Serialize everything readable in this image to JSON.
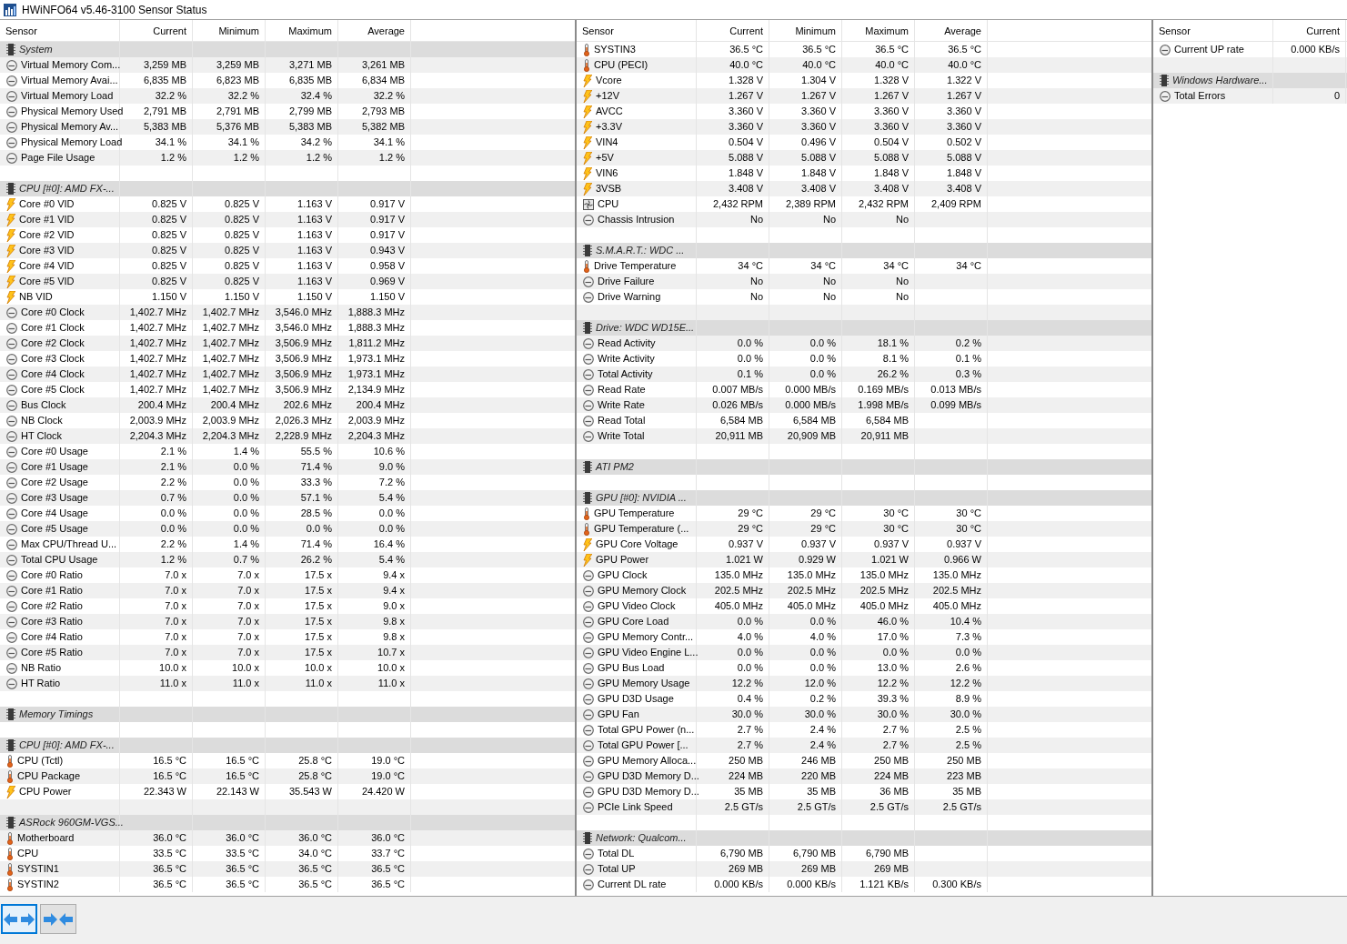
{
  "window": {
    "title": "HWiNFO64 v5.46-3100 Sensor Status"
  },
  "panels": [
    {
      "columns": [
        "Sensor",
        "Current",
        "Minimum",
        "Maximum",
        "Average"
      ],
      "rows": [
        {
          "kind": "group",
          "label": "System"
        },
        {
          "kind": "gauge",
          "label": "Virtual Memory Com...",
          "values": [
            "3,259 MB",
            "3,259 MB",
            "3,271 MB",
            "3,261 MB"
          ]
        },
        {
          "kind": "gauge",
          "label": "Virtual Memory Avai...",
          "values": [
            "6,835 MB",
            "6,823 MB",
            "6,835 MB",
            "6,834 MB"
          ]
        },
        {
          "kind": "gauge",
          "label": "Virtual Memory Load",
          "values": [
            "32.2 %",
            "32.2 %",
            "32.4 %",
            "32.2 %"
          ]
        },
        {
          "kind": "gauge",
          "label": "Physical Memory Used",
          "values": [
            "2,791 MB",
            "2,791 MB",
            "2,799 MB",
            "2,793 MB"
          ]
        },
        {
          "kind": "gauge",
          "label": "Physical Memory Av...",
          "values": [
            "5,383 MB",
            "5,376 MB",
            "5,383 MB",
            "5,382 MB"
          ]
        },
        {
          "kind": "gauge",
          "label": "Physical Memory Load",
          "values": [
            "34.1 %",
            "34.1 %",
            "34.2 %",
            "34.1 %"
          ]
        },
        {
          "kind": "gauge",
          "label": "Page File Usage",
          "values": [
            "1.2 %",
            "1.2 %",
            "1.2 %",
            "1.2 %"
          ]
        },
        {
          "kind": "blank"
        },
        {
          "kind": "group",
          "label": "CPU [#0]: AMD FX-..."
        },
        {
          "kind": "volt",
          "label": "Core #0 VID",
          "values": [
            "0.825 V",
            "0.825 V",
            "1.163 V",
            "0.917 V"
          ]
        },
        {
          "kind": "volt",
          "label": "Core #1 VID",
          "values": [
            "0.825 V",
            "0.825 V",
            "1.163 V",
            "0.917 V"
          ]
        },
        {
          "kind": "volt",
          "label": "Core #2 VID",
          "values": [
            "0.825 V",
            "0.825 V",
            "1.163 V",
            "0.917 V"
          ]
        },
        {
          "kind": "volt",
          "label": "Core #3 VID",
          "values": [
            "0.825 V",
            "0.825 V",
            "1.163 V",
            "0.943 V"
          ]
        },
        {
          "kind": "volt",
          "label": "Core #4 VID",
          "values": [
            "0.825 V",
            "0.825 V",
            "1.163 V",
            "0.958 V"
          ]
        },
        {
          "kind": "volt",
          "label": "Core #5 VID",
          "values": [
            "0.825 V",
            "0.825 V",
            "1.163 V",
            "0.969 V"
          ]
        },
        {
          "kind": "volt",
          "label": "NB VID",
          "values": [
            "1.150 V",
            "1.150 V",
            "1.150 V",
            "1.150 V"
          ]
        },
        {
          "kind": "gauge",
          "label": "Core #0 Clock",
          "values": [
            "1,402.7 MHz",
            "1,402.7 MHz",
            "3,546.0 MHz",
            "1,888.3 MHz"
          ]
        },
        {
          "kind": "gauge",
          "label": "Core #1 Clock",
          "values": [
            "1,402.7 MHz",
            "1,402.7 MHz",
            "3,546.0 MHz",
            "1,888.3 MHz"
          ]
        },
        {
          "kind": "gauge",
          "label": "Core #2 Clock",
          "values": [
            "1,402.7 MHz",
            "1,402.7 MHz",
            "3,506.9 MHz",
            "1,811.2 MHz"
          ]
        },
        {
          "kind": "gauge",
          "label": "Core #3 Clock",
          "values": [
            "1,402.7 MHz",
            "1,402.7 MHz",
            "3,506.9 MHz",
            "1,973.1 MHz"
          ]
        },
        {
          "kind": "gauge",
          "label": "Core #4 Clock",
          "values": [
            "1,402.7 MHz",
            "1,402.7 MHz",
            "3,506.9 MHz",
            "1,973.1 MHz"
          ]
        },
        {
          "kind": "gauge",
          "label": "Core #5 Clock",
          "values": [
            "1,402.7 MHz",
            "1,402.7 MHz",
            "3,506.9 MHz",
            "2,134.9 MHz"
          ]
        },
        {
          "kind": "gauge",
          "label": "Bus Clock",
          "values": [
            "200.4 MHz",
            "200.4 MHz",
            "202.6 MHz",
            "200.4 MHz"
          ]
        },
        {
          "kind": "gauge",
          "label": "NB Clock",
          "values": [
            "2,003.9 MHz",
            "2,003.9 MHz",
            "2,026.3 MHz",
            "2,003.9 MHz"
          ]
        },
        {
          "kind": "gauge",
          "label": "HT Clock",
          "values": [
            "2,204.3 MHz",
            "2,204.3 MHz",
            "2,228.9 MHz",
            "2,204.3 MHz"
          ]
        },
        {
          "kind": "gauge",
          "label": "Core #0 Usage",
          "values": [
            "2.1 %",
            "1.4 %",
            "55.5 %",
            "10.6 %"
          ]
        },
        {
          "kind": "gauge",
          "label": "Core #1 Usage",
          "values": [
            "2.1 %",
            "0.0 %",
            "71.4 %",
            "9.0 %"
          ]
        },
        {
          "kind": "gauge",
          "label": "Core #2 Usage",
          "values": [
            "2.2 %",
            "0.0 %",
            "33.3 %",
            "7.2 %"
          ]
        },
        {
          "kind": "gauge",
          "label": "Core #3 Usage",
          "values": [
            "0.7 %",
            "0.0 %",
            "57.1 %",
            "5.4 %"
          ]
        },
        {
          "kind": "gauge",
          "label": "Core #4 Usage",
          "values": [
            "0.0 %",
            "0.0 %",
            "28.5 %",
            "0.0 %"
          ]
        },
        {
          "kind": "gauge",
          "label": "Core #5 Usage",
          "values": [
            "0.0 %",
            "0.0 %",
            "0.0 %",
            "0.0 %"
          ]
        },
        {
          "kind": "gauge",
          "label": "Max CPU/Thread U...",
          "values": [
            "2.2 %",
            "1.4 %",
            "71.4 %",
            "16.4 %"
          ]
        },
        {
          "kind": "gauge",
          "label": "Total CPU Usage",
          "values": [
            "1.2 %",
            "0.7 %",
            "26.2 %",
            "5.4 %"
          ]
        },
        {
          "kind": "gauge",
          "label": "Core #0 Ratio",
          "values": [
            "7.0 x",
            "7.0 x",
            "17.5 x",
            "9.4 x"
          ]
        },
        {
          "kind": "gauge",
          "label": "Core #1 Ratio",
          "values": [
            "7.0 x",
            "7.0 x",
            "17.5 x",
            "9.4 x"
          ]
        },
        {
          "kind": "gauge",
          "label": "Core #2 Ratio",
          "values": [
            "7.0 x",
            "7.0 x",
            "17.5 x",
            "9.0 x"
          ]
        },
        {
          "kind": "gauge",
          "label": "Core #3 Ratio",
          "values": [
            "7.0 x",
            "7.0 x",
            "17.5 x",
            "9.8 x"
          ]
        },
        {
          "kind": "gauge",
          "label": "Core #4 Ratio",
          "values": [
            "7.0 x",
            "7.0 x",
            "17.5 x",
            "9.8 x"
          ]
        },
        {
          "kind": "gauge",
          "label": "Core #5 Ratio",
          "values": [
            "7.0 x",
            "7.0 x",
            "17.5 x",
            "10.7 x"
          ]
        },
        {
          "kind": "gauge",
          "label": "NB Ratio",
          "values": [
            "10.0 x",
            "10.0 x",
            "10.0 x",
            "10.0 x"
          ]
        },
        {
          "kind": "gauge",
          "label": "HT Ratio",
          "values": [
            "11.0 x",
            "11.0 x",
            "11.0 x",
            "11.0 x"
          ]
        },
        {
          "kind": "blank"
        },
        {
          "kind": "group",
          "label": "Memory Timings"
        },
        {
          "kind": "blank"
        },
        {
          "kind": "group",
          "label": "CPU [#0]: AMD FX-..."
        },
        {
          "kind": "temp",
          "label": "CPU (Tctl)",
          "values": [
            "16.5 °C",
            "16.5 °C",
            "25.8 °C",
            "19.0 °C"
          ]
        },
        {
          "kind": "temp",
          "label": "CPU Package",
          "values": [
            "16.5 °C",
            "16.5 °C",
            "25.8 °C",
            "19.0 °C"
          ]
        },
        {
          "kind": "volt",
          "label": "CPU Power",
          "values": [
            "22.343 W",
            "22.143 W",
            "35.543 W",
            "24.420 W"
          ]
        },
        {
          "kind": "blank"
        },
        {
          "kind": "group",
          "label": "ASRock 960GM-VGS..."
        },
        {
          "kind": "temp",
          "label": "Motherboard",
          "values": [
            "36.0 °C",
            "36.0 °C",
            "36.0 °C",
            "36.0 °C"
          ]
        },
        {
          "kind": "temp",
          "label": "CPU",
          "values": [
            "33.5 °C",
            "33.5 °C",
            "34.0 °C",
            "33.7 °C"
          ]
        },
        {
          "kind": "temp",
          "label": "SYSTIN1",
          "values": [
            "36.5 °C",
            "36.5 °C",
            "36.5 °C",
            "36.5 °C"
          ]
        },
        {
          "kind": "temp",
          "label": "SYSTIN2",
          "values": [
            "36.5 °C",
            "36.5 °C",
            "36.5 °C",
            "36.5 °C"
          ]
        }
      ]
    },
    {
      "columns": [
        "Sensor",
        "Current",
        "Minimum",
        "Maximum",
        "Average"
      ],
      "rows": [
        {
          "kind": "temp",
          "label": "SYSTIN3",
          "values": [
            "36.5 °C",
            "36.5 °C",
            "36.5 °C",
            "36.5 °C"
          ]
        },
        {
          "kind": "temp",
          "label": "CPU (PECI)",
          "values": [
            "40.0 °C",
            "40.0 °C",
            "40.0 °C",
            "40.0 °C"
          ]
        },
        {
          "kind": "volt",
          "label": "Vcore",
          "values": [
            "1.328 V",
            "1.304 V",
            "1.328 V",
            "1.322 V"
          ]
        },
        {
          "kind": "volt",
          "label": "+12V",
          "values": [
            "1.267 V",
            "1.267 V",
            "1.267 V",
            "1.267 V"
          ]
        },
        {
          "kind": "volt",
          "label": "AVCC",
          "values": [
            "3.360 V",
            "3.360 V",
            "3.360 V",
            "3.360 V"
          ]
        },
        {
          "kind": "volt",
          "label": "+3.3V",
          "values": [
            "3.360 V",
            "3.360 V",
            "3.360 V",
            "3.360 V"
          ]
        },
        {
          "kind": "volt",
          "label": "VIN4",
          "values": [
            "0.504 V",
            "0.496 V",
            "0.504 V",
            "0.502 V"
          ]
        },
        {
          "kind": "volt",
          "label": "+5V",
          "values": [
            "5.088 V",
            "5.088 V",
            "5.088 V",
            "5.088 V"
          ]
        },
        {
          "kind": "volt",
          "label": "VIN6",
          "values": [
            "1.848 V",
            "1.848 V",
            "1.848 V",
            "1.848 V"
          ]
        },
        {
          "kind": "volt",
          "label": "3VSB",
          "values": [
            "3.408 V",
            "3.408 V",
            "3.408 V",
            "3.408 V"
          ]
        },
        {
          "kind": "fan",
          "label": "CPU",
          "values": [
            "2,432 RPM",
            "2,389 RPM",
            "2,432 RPM",
            "2,409 RPM"
          ]
        },
        {
          "kind": "gauge",
          "label": "Chassis Intrusion",
          "values": [
            "No",
            "No",
            "No"
          ]
        },
        {
          "kind": "blank"
        },
        {
          "kind": "group",
          "label": "S.M.A.R.T.: WDC ..."
        },
        {
          "kind": "temp",
          "label": "Drive Temperature",
          "values": [
            "34 °C",
            "34 °C",
            "34 °C",
            "34 °C"
          ]
        },
        {
          "kind": "gauge",
          "label": "Drive Failure",
          "values": [
            "No",
            "No",
            "No"
          ]
        },
        {
          "kind": "gauge",
          "label": "Drive Warning",
          "values": [
            "No",
            "No",
            "No"
          ]
        },
        {
          "kind": "blank"
        },
        {
          "kind": "group",
          "label": "Drive: WDC WD15E..."
        },
        {
          "kind": "gauge",
          "label": "Read Activity",
          "values": [
            "0.0 %",
            "0.0 %",
            "18.1 %",
            "0.2 %"
          ]
        },
        {
          "kind": "gauge",
          "label": "Write Activity",
          "values": [
            "0.0 %",
            "0.0 %",
            "8.1 %",
            "0.1 %"
          ]
        },
        {
          "kind": "gauge",
          "label": "Total Activity",
          "values": [
            "0.1 %",
            "0.0 %",
            "26.2 %",
            "0.3 %"
          ]
        },
        {
          "kind": "gauge",
          "label": "Read Rate",
          "values": [
            "0.007 MB/s",
            "0.000 MB/s",
            "0.169 MB/s",
            "0.013 MB/s"
          ]
        },
        {
          "kind": "gauge",
          "label": "Write Rate",
          "values": [
            "0.026 MB/s",
            "0.000 MB/s",
            "1.998 MB/s",
            "0.099 MB/s"
          ]
        },
        {
          "kind": "gauge",
          "label": "Read Total",
          "values": [
            "6,584 MB",
            "6,584 MB",
            "6,584 MB"
          ]
        },
        {
          "kind": "gauge",
          "label": "Write Total",
          "values": [
            "20,911 MB",
            "20,909 MB",
            "20,911 MB"
          ]
        },
        {
          "kind": "blank"
        },
        {
          "kind": "group",
          "label": "ATI PM2"
        },
        {
          "kind": "blank"
        },
        {
          "kind": "group",
          "label": "GPU [#0]: NVIDIA ..."
        },
        {
          "kind": "temp",
          "label": "GPU Temperature",
          "values": [
            "29 °C",
            "29 °C",
            "30 °C",
            "30 °C"
          ]
        },
        {
          "kind": "temp",
          "label": "GPU Temperature (...",
          "values": [
            "29 °C",
            "29 °C",
            "30 °C",
            "30 °C"
          ]
        },
        {
          "kind": "volt",
          "label": "GPU Core Voltage",
          "values": [
            "0.937 V",
            "0.937 V",
            "0.937 V",
            "0.937 V"
          ]
        },
        {
          "kind": "volt",
          "label": "GPU Power",
          "values": [
            "1.021 W",
            "0.929 W",
            "1.021 W",
            "0.966 W"
          ]
        },
        {
          "kind": "gauge",
          "label": "GPU Clock",
          "values": [
            "135.0 MHz",
            "135.0 MHz",
            "135.0 MHz",
            "135.0 MHz"
          ]
        },
        {
          "kind": "gauge",
          "label": "GPU Memory Clock",
          "values": [
            "202.5 MHz",
            "202.5 MHz",
            "202.5 MHz",
            "202.5 MHz"
          ]
        },
        {
          "kind": "gauge",
          "label": "GPU Video Clock",
          "values": [
            "405.0 MHz",
            "405.0 MHz",
            "405.0 MHz",
            "405.0 MHz"
          ]
        },
        {
          "kind": "gauge",
          "label": "GPU Core Load",
          "values": [
            "0.0 %",
            "0.0 %",
            "46.0 %",
            "10.4 %"
          ]
        },
        {
          "kind": "gauge",
          "label": "GPU Memory Contr...",
          "values": [
            "4.0 %",
            "4.0 %",
            "17.0 %",
            "7.3 %"
          ]
        },
        {
          "kind": "gauge",
          "label": "GPU Video Engine L...",
          "values": [
            "0.0 %",
            "0.0 %",
            "0.0 %",
            "0.0 %"
          ]
        },
        {
          "kind": "gauge",
          "label": "GPU Bus Load",
          "values": [
            "0.0 %",
            "0.0 %",
            "13.0 %",
            "2.6 %"
          ]
        },
        {
          "kind": "gauge",
          "label": "GPU Memory Usage",
          "values": [
            "12.2 %",
            "12.0 %",
            "12.2 %",
            "12.2 %"
          ]
        },
        {
          "kind": "gauge",
          "label": "GPU D3D Usage",
          "values": [
            "0.4 %",
            "0.2 %",
            "39.3 %",
            "8.9 %"
          ]
        },
        {
          "kind": "gauge",
          "label": "GPU Fan",
          "values": [
            "30.0 %",
            "30.0 %",
            "30.0 %",
            "30.0 %"
          ]
        },
        {
          "kind": "gauge",
          "label": "Total GPU Power (n...",
          "values": [
            "2.7 %",
            "2.4 %",
            "2.7 %",
            "2.5 %"
          ]
        },
        {
          "kind": "gauge",
          "label": "Total GPU Power [...",
          "values": [
            "2.7 %",
            "2.4 %",
            "2.7 %",
            "2.5 %"
          ]
        },
        {
          "kind": "gauge",
          "label": "GPU Memory Alloca...",
          "values": [
            "250 MB",
            "246 MB",
            "250 MB",
            "250 MB"
          ]
        },
        {
          "kind": "gauge",
          "label": "GPU D3D Memory D...",
          "values": [
            "224 MB",
            "220 MB",
            "224 MB",
            "223 MB"
          ]
        },
        {
          "kind": "gauge",
          "label": "GPU D3D Memory D...",
          "values": [
            "35 MB",
            "35 MB",
            "36 MB",
            "35 MB"
          ]
        },
        {
          "kind": "gauge",
          "label": "PCIe Link Speed",
          "values": [
            "2.5 GT/s",
            "2.5 GT/s",
            "2.5 GT/s",
            "2.5 GT/s"
          ]
        },
        {
          "kind": "blank"
        },
        {
          "kind": "group",
          "label": "Network: Qualcom..."
        },
        {
          "kind": "gauge",
          "label": "Total DL",
          "values": [
            "6,790 MB",
            "6,790 MB",
            "6,790 MB"
          ]
        },
        {
          "kind": "gauge",
          "label": "Total UP",
          "values": [
            "269 MB",
            "269 MB",
            "269 MB"
          ]
        },
        {
          "kind": "gauge",
          "label": "Current DL rate",
          "values": [
            "0.000 KB/s",
            "0.000 KB/s",
            "1.121 KB/s",
            "0.300 KB/s"
          ]
        }
      ]
    },
    {
      "columns": [
        "Sensor",
        "Current"
      ],
      "rows": [
        {
          "kind": "gauge",
          "label": "Current UP rate",
          "values": [
            "0.000 KB/s"
          ]
        },
        {
          "kind": "blank"
        },
        {
          "kind": "group",
          "label": "Windows Hardware..."
        },
        {
          "kind": "gauge",
          "label": "Total Errors",
          "values": [
            "0"
          ]
        }
      ]
    }
  ],
  "toolbar": [
    {
      "kind": "expand",
      "selected": true
    },
    {
      "kind": "collapse",
      "selected": false
    }
  ]
}
